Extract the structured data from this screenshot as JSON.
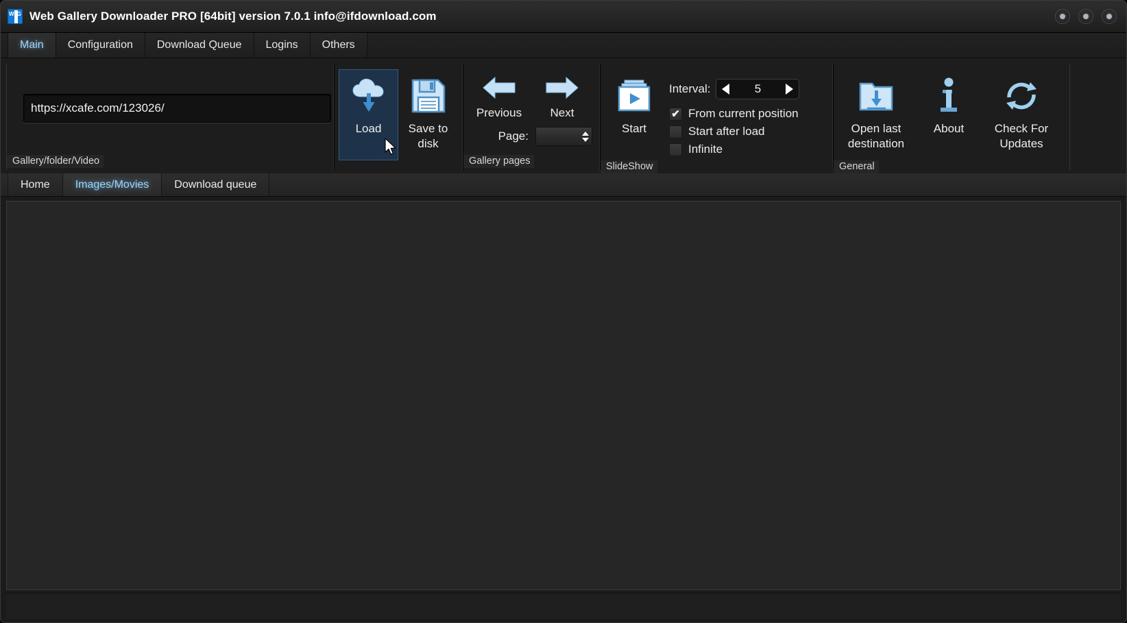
{
  "window": {
    "title": "Web Gallery Downloader PRO [64bit] version 7.0.1 info@ifdownload.com",
    "icon_name": "app-logo-icon",
    "controls": [
      {
        "name": "minimize-button"
      },
      {
        "name": "maximize-button"
      },
      {
        "name": "close-button"
      }
    ]
  },
  "ribbon_tabs": [
    {
      "label": "Main",
      "active": true
    },
    {
      "label": "Configuration",
      "active": false
    },
    {
      "label": "Download Queue",
      "active": false
    },
    {
      "label": "Logins",
      "active": false
    },
    {
      "label": "Others",
      "active": false
    }
  ],
  "groups": {
    "url": {
      "label": "Gallery/folder/Video",
      "input_value": "https://xcafe.com/123026/",
      "input_placeholder": "https://"
    },
    "load_save": {
      "load_label": "Load",
      "load_icon": "cloud-download-icon",
      "load_hovered": true,
      "save_label": "Save to disk",
      "save_icon": "floppy-disk-icon"
    },
    "gallery_pages": {
      "label": "Gallery pages",
      "previous_label": "Previous",
      "previous_icon": "arrow-left-icon",
      "next_label": "Next",
      "next_icon": "arrow-right-icon",
      "page_label": "Page:",
      "page_value": ""
    },
    "slideshow": {
      "label": "SlideShow",
      "start_label": "Start",
      "start_icon": "slideshow-play-icon",
      "interval_label": "Interval:",
      "interval_value": "5",
      "interval_dec_icon": "arrow-left-triangle-icon",
      "interval_inc_icon": "arrow-right-triangle-icon",
      "checkboxes": [
        {
          "label": "From current position",
          "checked": true
        },
        {
          "label": "Start after load",
          "checked": false
        },
        {
          "label": "Infinite",
          "checked": false
        }
      ]
    },
    "general": {
      "label": "General",
      "items": [
        {
          "label": "Open last destination",
          "icon": "folder-download-icon"
        },
        {
          "label": "About",
          "icon": "info-icon"
        },
        {
          "label": "Check For Updates",
          "icon": "refresh-sync-icon"
        }
      ]
    }
  },
  "lower_tabs": [
    {
      "label": "Home",
      "active": false
    },
    {
      "label": "Images/Movies",
      "active": true
    },
    {
      "label": "Download queue",
      "active": false
    }
  ],
  "colors": {
    "accent": "#9fd4f5",
    "icon_blue": "#bcdcf5",
    "icon_blue_dark": "#3f8fd0",
    "hover_bg": "#1e3349",
    "window_bg": "#1b1b1b"
  },
  "status_bar": {
    "text": ""
  }
}
